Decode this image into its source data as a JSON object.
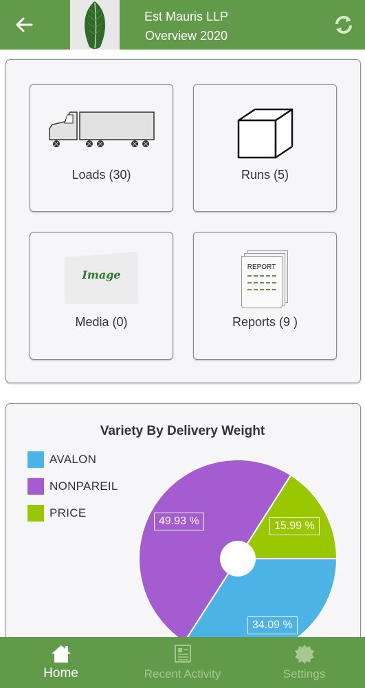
{
  "header": {
    "title_line1": "Est Mauris LLP",
    "title_line2": "Overview 2020",
    "back_icon": "arrow-left-icon",
    "refresh_icon": "refresh-icon",
    "brand_color": "#619a48"
  },
  "tiles": [
    {
      "id": "loads",
      "label": "Loads (30)",
      "icon": "truck-icon"
    },
    {
      "id": "runs",
      "label": "Runs (5)",
      "icon": "cube-icon"
    },
    {
      "id": "media",
      "label": "Media (0)",
      "icon": "image-icon",
      "icon_text": "Image"
    },
    {
      "id": "reports",
      "label": "Reports (9 )",
      "icon": "report-icon",
      "icon_text": "REPORT"
    }
  ],
  "chart": {
    "title": "Variety By Delivery Weight",
    "legend": [
      {
        "name": "AVALON",
        "color": "#4bb3e6"
      },
      {
        "name": "NONPAREIL",
        "color": "#a55cd0"
      },
      {
        "name": "PRICE",
        "color": "#99c800"
      }
    ]
  },
  "chart_data": {
    "type": "pie",
    "title": "Variety By Delivery Weight",
    "categories": [
      "AVALON",
      "NONPAREIL",
      "PRICE"
    ],
    "values": [
      34.09,
      49.93,
      15.99
    ],
    "labels": [
      "34.09 %",
      "49.93 %",
      "15.99 %"
    ],
    "colors": [
      "#4bb3e6",
      "#a55cd0",
      "#99c800"
    ],
    "legend_position": "top-left"
  },
  "bottom_nav": [
    {
      "label": "Home",
      "icon": "home-icon",
      "active": true
    },
    {
      "label": "Recent Activity",
      "icon": "activity-icon",
      "active": false
    },
    {
      "label": "Settings",
      "icon": "settings-icon",
      "active": false
    }
  ]
}
